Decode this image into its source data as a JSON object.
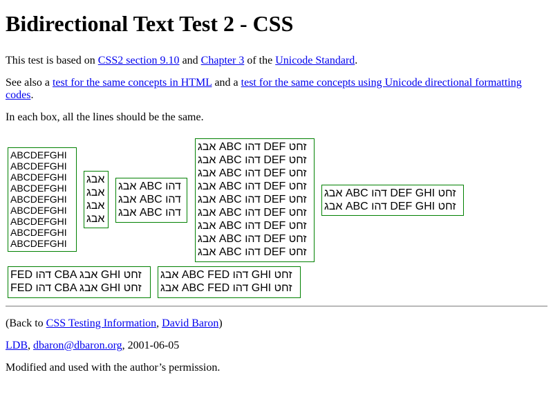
{
  "title": "Bidirectional Text Test 2 - CSS",
  "intro": {
    "prefix": "This test is based on ",
    "link1": "CSS2 section 9.10",
    "mid": " and ",
    "link2": "Chapter 3",
    "mid2": " of the ",
    "link3": "Unicode Standard",
    "suffix": "."
  },
  "seealso": {
    "prefix": "See also a ",
    "link1": "test for the same concepts in HTML",
    "mid": " and a ",
    "link2": "test for the same concepts using Unicode directional formatting codes",
    "suffix": "."
  },
  "instruction": "In each box, all the lines should be the same.",
  "boxes": {
    "box1": [
      "ABCDEFGHI",
      "ABCDEFGHI",
      "ABCDEFGHI",
      "ABCDEFGHI",
      "ABCDEFGHI",
      "ABCDEFGHI",
      "ABCDEFGHI",
      "ABCDEFGHI",
      "ABCDEFGHI"
    ],
    "box2": [
      "אבג",
      "אבג",
      "אבג",
      "אבג"
    ],
    "box3": [
      "אבג ABC דהו",
      "אבג ABC דהו",
      "אבג ABC דהו"
    ],
    "box4": [
      "אבג ABC דהו DEF זחט",
      "אבג ABC דהו DEF זחט",
      "אבג ABC דהו DEF זחט",
      "אבג ABC דהו DEF זחט",
      "אבג ABC דהו DEF זחט",
      "אבג ABC דהו DEF זחט",
      "אבג ABC דהו DEF זחט",
      "אבג ABC דהו DEF זחט",
      "אבג ABC דהו DEF זחט"
    ],
    "box5": [
      "אבג ABC דהו DEF GHI זחט",
      "אבג ABC דהו DEF GHI זחט"
    ],
    "box6": [
      "FED דהו CBA אבג GHI זחט",
      "FED דהו CBA אבג GHI זחט"
    ],
    "box7": [
      "אבג ABC FED דהו GHI זחט",
      "אבג ABC FED דהו GHI זחט"
    ]
  },
  "back": {
    "prefix": "(Back to ",
    "link1": "CSS Testing Information",
    "sep": ", ",
    "link2": "David Baron",
    "suffix": ")"
  },
  "signature": {
    "link1": "LDB",
    "sep": ", ",
    "link2": "dbaron@dbaron.org",
    "date": ", 2001-06-05"
  },
  "permission": "Modified and used with the author’s permission."
}
